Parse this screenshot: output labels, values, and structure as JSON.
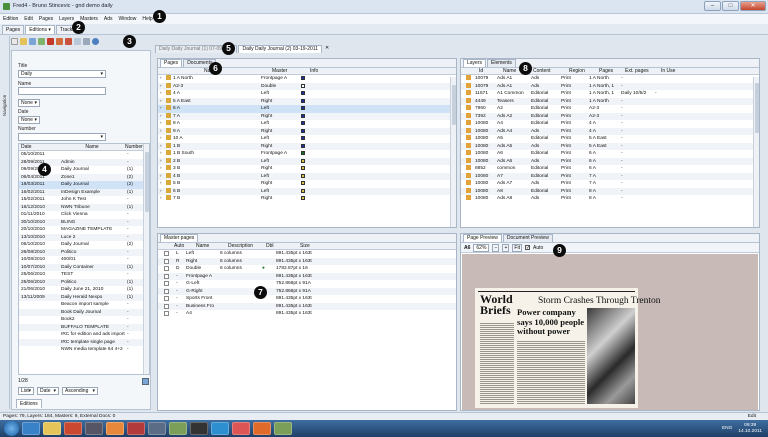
{
  "window": {
    "title": "Fred4 - Bruno Stincevic - gnd demo daily",
    "controls": [
      "–",
      "□",
      "✕"
    ]
  },
  "menu": [
    "Edition",
    "Edit",
    "Pages",
    "Layers",
    "Masters",
    "Ads",
    "Window",
    "Help"
  ],
  "main_tabs": [
    {
      "label": "Pages"
    },
    {
      "label": "Editions ▾"
    },
    {
      "label": "Tracking"
    }
  ],
  "doc_tabs": [
    "Daily Daily Journal (1) 07-09-20...",
    "Daily Daily Journal (2) 03-19-2011"
  ],
  "left": {
    "nav_label": "Navigation",
    "title_label": "Title",
    "title_value": "Daily",
    "name_label": "Name",
    "date_label": "Date",
    "date_value": "None",
    "number_label": "Number",
    "none1": "None",
    "columns": [
      "Date",
      "Name",
      "Number"
    ],
    "rows": [
      [
        "05/10/2011",
        "",
        "-"
      ],
      [
        "28/09/2011",
        "Admin",
        "-"
      ],
      [
        "09/09/2011",
        "Daily Journal",
        "(1)"
      ],
      [
        "06/04/2011",
        "Zone1",
        "(2)"
      ],
      [
        "18/03/2011",
        "Daily Journal",
        "(2)"
      ],
      [
        "16/02/2011",
        "InDesign Example",
        "(1)"
      ],
      [
        "15/02/2011",
        "John K Test",
        "-"
      ],
      [
        "16/12/2010",
        "NWN Tribune",
        "(1)"
      ],
      [
        "01/11/2010",
        "Click Vienna",
        "-"
      ],
      [
        "30/10/2010",
        "BLING",
        "-"
      ],
      [
        "20/10/2010",
        "MAGAZINE TEMPLATE",
        "-"
      ],
      [
        "13/10/2010",
        "Luce 2",
        "-"
      ],
      [
        "06/10/2010",
        "Daily Journal",
        "(2)"
      ],
      [
        "26/08/2010",
        "Politico",
        "-"
      ],
      [
        "10/08/2010",
        "400/01",
        "-"
      ],
      [
        "10/07/2010",
        "Daily Container",
        "(1)"
      ],
      [
        "25/06/2010",
        "TEST",
        "-"
      ],
      [
        "25/06/2010",
        "Politico",
        "(1)"
      ],
      [
        "21/06/2010",
        "Daily June 21, 2010",
        "(1)"
      ],
      [
        "13/11/2009",
        "Daily Herald Nexpo",
        "(1)"
      ],
      [
        "",
        "Beacon import sample",
        "-"
      ],
      [
        "",
        "Book Daily Journal",
        "-"
      ],
      [
        "",
        "Book2",
        "-"
      ],
      [
        "",
        "BUFFALO TEMPLATE",
        "-"
      ],
      [
        "",
        "IRC for edition and ads import",
        "-"
      ],
      [
        "",
        "IRC template single page",
        "-"
      ],
      [
        "",
        "NWN media template 64 4+2",
        "-"
      ]
    ],
    "count": "1/28",
    "footer_selects": [
      "List",
      "Date",
      "Ascending"
    ],
    "editions_tab": "Editions"
  },
  "pages_panel": {
    "tabs": [
      "Pages",
      "Documents"
    ],
    "columns": [
      "Name",
      "Master",
      "Info"
    ],
    "rows": [
      {
        "name": "1 A North",
        "master": "Frontpage A",
        "color": "#1c2f9c"
      },
      {
        "name": "A2-3",
        "master": "Double",
        "color": "#ffffff"
      },
      {
        "name": "4 A",
        "master": "Left",
        "color": "#1c2f9c"
      },
      {
        "name": "5 A East",
        "master": "Right",
        "color": "#1c2f9c"
      },
      {
        "name": "6 A",
        "master": "Left",
        "color": "#1c2f9c"
      },
      {
        "name": "7 A",
        "master": "Right",
        "color": "#1c2f9c"
      },
      {
        "name": "8 A",
        "master": "Left",
        "color": "#1c2f9c"
      },
      {
        "name": "9 A",
        "master": "Right",
        "color": "#1c2f9c"
      },
      {
        "name": "10 A",
        "master": "Left",
        "color": "#1c2f9c"
      },
      {
        "name": "1 B",
        "master": "Right",
        "color": "#1c2f9c"
      },
      {
        "name": "1 B South",
        "master": "Frontpage A",
        "color": "#1d6b28"
      },
      {
        "name": "2 B",
        "master": "Left",
        "color": "#d9c44a"
      },
      {
        "name": "3 B",
        "master": "Right",
        "color": "#d9c44a"
      },
      {
        "name": "4 B",
        "master": "Left",
        "color": "#d9c44a"
      },
      {
        "name": "5 B",
        "master": "Right",
        "color": "#d9c44a"
      },
      {
        "name": "6 B",
        "master": "Left",
        "color": "#d9c44a"
      },
      {
        "name": "7 B",
        "master": "Right",
        "color": "#d9c44a"
      }
    ]
  },
  "master_panel": {
    "tab": "Master pages",
    "columns": [
      "Auto",
      "Name",
      "Description",
      "Dbl",
      "Size"
    ],
    "rows": [
      {
        "auto": "L",
        "name": "Left",
        "desc": "6 columns",
        "dbl": "",
        "size": "891.435pt x 163t"
      },
      {
        "auto": "R",
        "name": "Right",
        "desc": "6 columns",
        "dbl": "",
        "size": "891.435pt x 163t"
      },
      {
        "auto": "D",
        "name": "Double",
        "desc": "6 columns",
        "dbl": "●",
        "size": "1782.87pt x 16"
      },
      {
        "auto": "-",
        "name": "Frontpage A",
        "desc": "",
        "dbl": "",
        "size": "891.435pt x 163t"
      },
      {
        "auto": "-",
        "name": "G-Left",
        "desc": "",
        "dbl": "",
        "size": "752.868pt x 91A"
      },
      {
        "auto": "-",
        "name": "G-Right",
        "desc": "",
        "dbl": "",
        "size": "752.868pt x 91A"
      },
      {
        "auto": "-",
        "name": "Sports Front",
        "desc": "",
        "dbl": "",
        "size": "891.435pt x 163t"
      },
      {
        "auto": "-",
        "name": "Business Fro",
        "desc": "",
        "dbl": "",
        "size": "891.435pt x 163t"
      },
      {
        "auto": "-",
        "name": "A4",
        "desc": "",
        "dbl": "",
        "size": "891.435pt x 163t"
      }
    ]
  },
  "layers_panel": {
    "tabs": [
      "Layers",
      "Elements"
    ],
    "columns": [
      "Id",
      "Name",
      "Content",
      "Region",
      "Pages",
      "Ext. pages",
      "In Use"
    ],
    "rows": [
      [
        "10079",
        "Ads A1",
        "Ads",
        "Print",
        "1 A North",
        "-",
        ""
      ],
      [
        "10079",
        "Ads A1",
        "Ads",
        "Print",
        "1 A North, 1",
        "-",
        ""
      ],
      [
        "11671",
        "A1 Common",
        "Editorial",
        "Print",
        "1 A North, 1",
        "Daily 10/5/2",
        "-"
      ],
      [
        "4449",
        "Teasers",
        "Editorial",
        "Print",
        "1 A North",
        "-",
        ""
      ],
      [
        "7960",
        "A2",
        "Editorial",
        "Print",
        "A2-3",
        "-",
        ""
      ],
      [
        "7392",
        "Ads A2",
        "Editorial",
        "Print",
        "A2-3",
        "-",
        ""
      ],
      [
        "10080",
        "A4",
        "Editorial",
        "Print",
        "4 A",
        "-",
        ""
      ],
      [
        "10080",
        "Ads A4",
        "Ads",
        "Print",
        "4 A",
        "-",
        ""
      ],
      [
        "10080",
        "A5",
        "Editorial",
        "Print",
        "5 A East",
        "-",
        ""
      ],
      [
        "10080",
        "Ads A5",
        "Ads",
        "Print",
        "5 A East",
        "-",
        ""
      ],
      [
        "10080",
        "A6",
        "Editorial",
        "Print",
        "6 A",
        "-",
        ""
      ],
      [
        "10080",
        "Ads A6",
        "Ads",
        "Print",
        "6 A",
        "-",
        ""
      ],
      [
        "8852",
        "common",
        "Editorial",
        "Print",
        "6 A",
        "-",
        ""
      ],
      [
        "10080",
        "A7",
        "Editorial",
        "Print",
        "7 A",
        "-",
        ""
      ],
      [
        "10080",
        "Ads A7",
        "Ads",
        "Print",
        "7 A",
        "-",
        ""
      ],
      [
        "10080",
        "A8",
        "Editorial",
        "Print",
        "8 A",
        "-",
        ""
      ],
      [
        "10080",
        "Ads A8",
        "Ads",
        "Print",
        "8 A",
        "-",
        ""
      ]
    ]
  },
  "preview_panel": {
    "tabs": [
      "Page Preview",
      "Document Preview"
    ],
    "page_label": "A6",
    "zoom": "62%",
    "fit_label": "Fit",
    "auto_label": "Auto",
    "paper": {
      "masthead": [
        "World",
        "Briefs"
      ],
      "headline": "Storm Crashes Through Trenton",
      "subhead": "Power company says 10,000 people without power"
    }
  },
  "statusbar": {
    "text": "Pages: 79, Layers: 184, Masters: 9, External Docs: 0",
    "mode": "Edit"
  },
  "tray": {
    "lang": "ENG",
    "time": "09:39",
    "date": "14.10.2011"
  },
  "callouts": [
    "1",
    "2",
    "3",
    "4",
    "5",
    "6",
    "7",
    "8",
    "9"
  ]
}
